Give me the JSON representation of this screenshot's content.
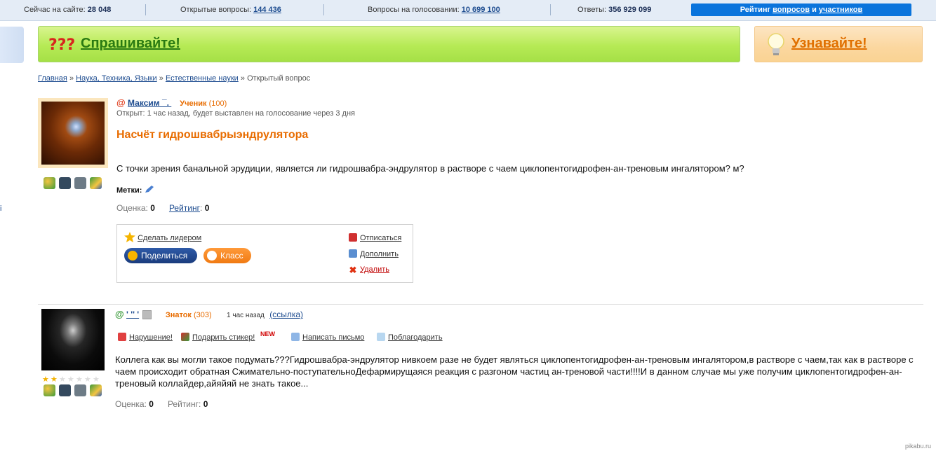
{
  "stats": {
    "online_label": "Сейчас на сайте:",
    "online_value": "28 048",
    "open_label": "Открытые вопросы:",
    "open_value": "144 436",
    "voting_label": "Вопросы на голосовании:",
    "voting_value": "10 699 100",
    "answers_label": "Ответы:",
    "answers_value": "356 929 099",
    "rating_prefix": "Рейтинг",
    "rating_questions": "вопросов",
    "rating_and": "и",
    "rating_participants": "участников"
  },
  "banners": {
    "ask": "Спрашивайте!",
    "learn": "Узнавайте!"
  },
  "breadcrumb": {
    "home": "Главная",
    "sep": "»",
    "category": "Наука, Техника, Языки",
    "subcategory": "Естественные науки",
    "current": "Открытый вопрос"
  },
  "question": {
    "at": "@",
    "author": "Максим ¯.      ",
    "rank": "Ученик",
    "points": "(100)",
    "opened": "Открыт: 1 час назад, будет выставлен на голосование через 3 дня",
    "title": "Насчёт гидрошвабрыэндрулятора",
    "text": "С точки зрения банальной эрудиции, является ли гидрошвабра-эндрулятор в растворе с чаем циклопентогидрофен-ан-треновым ингалятором? м?",
    "tags_label": "Метки:",
    "score_label": "Оценка:",
    "score_value": "0",
    "rating_label": "Рейтинг",
    "rating_value": "0",
    "actions": {
      "make_leader": "Сделать лидером",
      "share": "Поделиться",
      "klass": "Класс",
      "unsubscribe": "Отписаться",
      "add": "Дополнить",
      "delete": "Удалить"
    }
  },
  "answer": {
    "at": "@",
    "author": "  ' '' '",
    "rank": "Знаток",
    "points": "(303)",
    "time": "1 час назад",
    "link": "(ссылка)",
    "violation": "Нарушение!",
    "sticker": "Подарить стикер!",
    "new_badge": "NEW",
    "write": "Написать письмо",
    "thank": "Поблагодарить",
    "text": "Коллега как вы могли такое подумать???Гидрошвабра-эндрулятор нивкоем разе не будет являться циклопентогидрофен-ан-треновым ингалятором,в растворе с чаем,так как в растворе с чаем происходит обратная Сжимательно-поступательноДефармирущаяся реакция с разгоном частиц ан-треновой части!!!!И в данном случае мы уже получим циклопентогидрофен-ан-треновый коллайдер,айяйяй не знать такое...",
    "score_label": "Оценка:",
    "score_value": "0",
    "rating_label": "Рейтинг:",
    "rating_value": "0",
    "stars_filled": 2,
    "stars_total": 7
  },
  "left_edge": "і",
  "watermark": "pikabu.ru",
  "icons": [
    "user-icon",
    "camera-icon",
    "video-icon",
    "pencil-icon",
    "star-icon",
    "share-icon",
    "odnoklassniki-icon",
    "unsubscribe-icon",
    "add-icon",
    "delete-icon",
    "warning-icon",
    "gift-icon",
    "mail-icon",
    "thanks-icon",
    "question-marks-icon",
    "bulb-icon"
  ]
}
